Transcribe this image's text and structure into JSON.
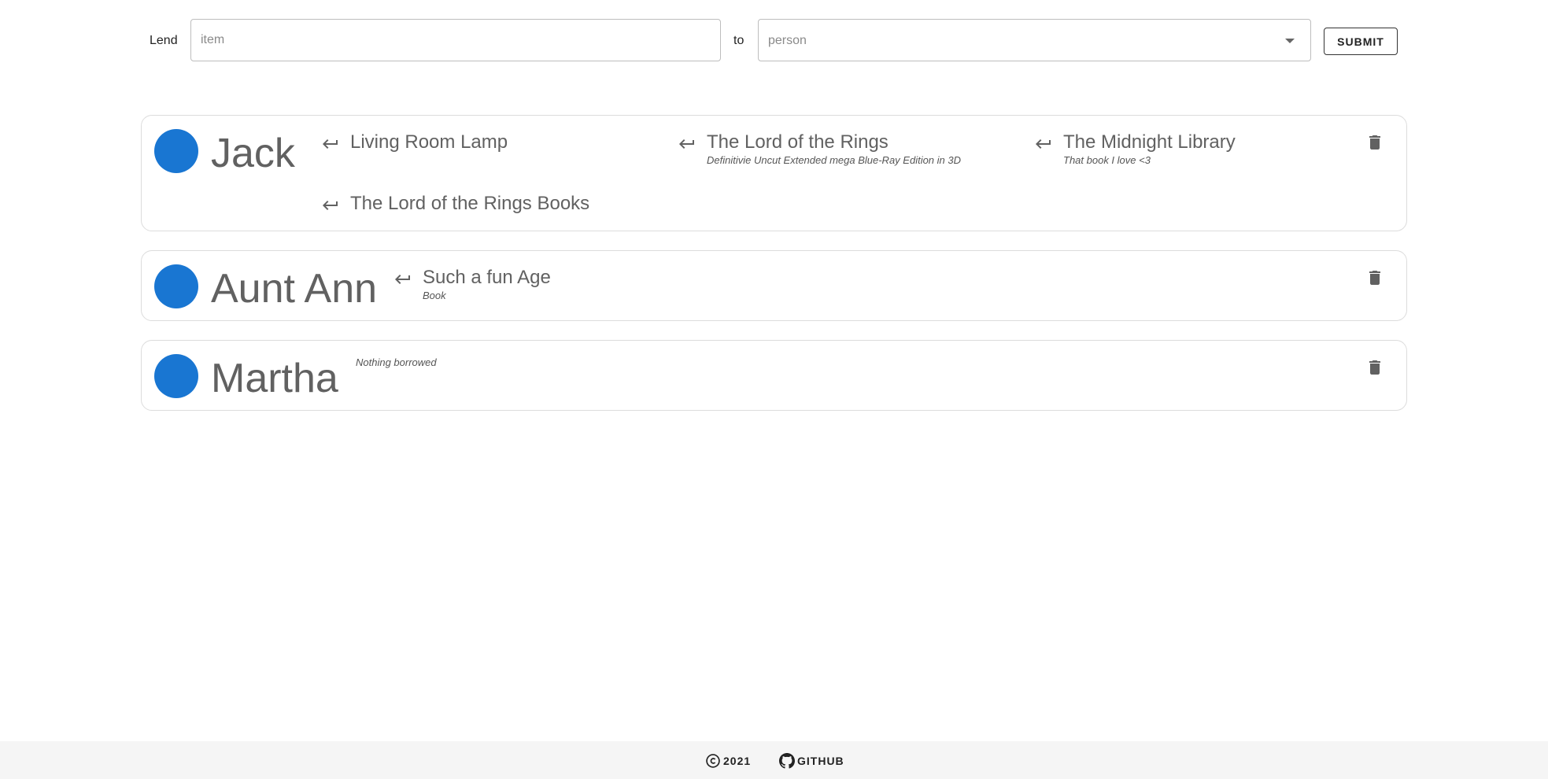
{
  "form": {
    "lend_label": "Lend",
    "item_placeholder": "item",
    "to_label": "to",
    "person_placeholder": "person",
    "submit_label": "SUBMIT"
  },
  "people": [
    {
      "name": "Jack",
      "loans": [
        {
          "title": "Living Room Lamp",
          "desc": ""
        },
        {
          "title": "The Lord of the Rings",
          "desc": "Definitivie Uncut Extended mega Blue-Ray Edition in 3D"
        },
        {
          "title": "The Midnight Library",
          "desc": "That book I love <3"
        },
        {
          "title": "The Lord of the Rings Books",
          "desc": ""
        }
      ]
    },
    {
      "name": "Aunt Ann",
      "loans": [
        {
          "title": "Such a fun Age",
          "desc": "Book"
        }
      ]
    },
    {
      "name": "Martha",
      "empty_text": "Nothing borrowed"
    }
  ],
  "footer": {
    "copyright": "2021",
    "github": "GITHUB"
  },
  "colors": {
    "avatar": "#1976d2",
    "footer_bg": "#f5f5f5"
  },
  "icons": {
    "return": "keyboard-return-icon",
    "delete": "trash-icon",
    "dropdown": "caret-down-icon",
    "copyright": "copyright-icon",
    "github": "github-icon"
  }
}
